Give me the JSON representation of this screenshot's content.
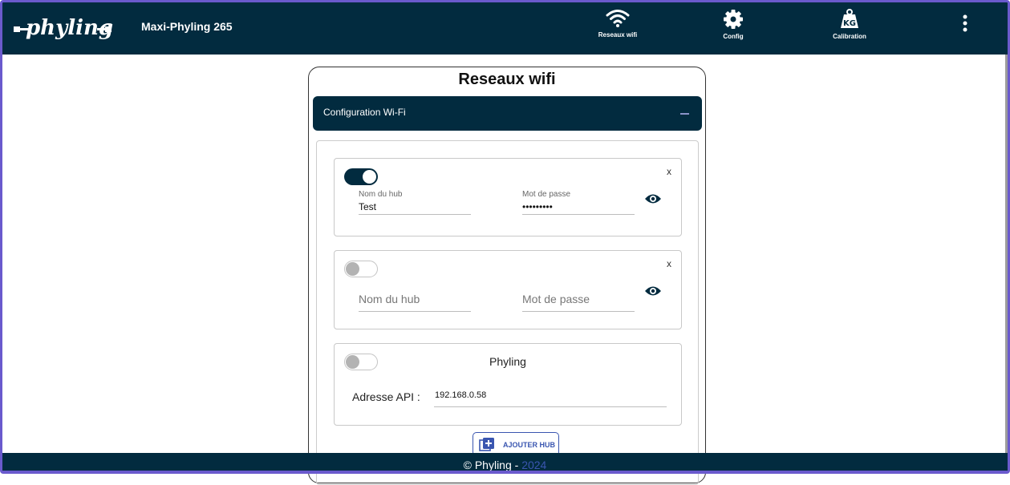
{
  "header": {
    "brand": "phyling",
    "app_title": "Maxi-Phyling 265",
    "nav": [
      {
        "label": "Reseaux wifi",
        "icon": "wifi-icon"
      },
      {
        "label": "Config",
        "icon": "gear-icon"
      },
      {
        "label": "Calibration",
        "icon": "weight-kg-icon"
      }
    ],
    "more_icon": "more-vertical-icon"
  },
  "main": {
    "title": "Reseaux wifi",
    "accordion": {
      "title": "Configuration Wi-Fi",
      "collapse_icon": "minus-icon"
    },
    "hubs": [
      {
        "enabled": true,
        "name_label": "Nom du hub",
        "name_value": "Test",
        "password_label": "Mot de passe",
        "password_value": "•••••••••",
        "remove_label": "x"
      },
      {
        "enabled": false,
        "name_placeholder": "Nom du hub",
        "password_placeholder": "Mot de passe",
        "remove_label": "x"
      }
    ],
    "phyling_hub": {
      "enabled": false,
      "name": "Phyling",
      "api_label": "Adresse API :",
      "api_value": "192.168.0.58"
    },
    "add_hub_label": "AJOUTER HUB"
  },
  "footer": {
    "text": "© Phyling - ",
    "year": "2024"
  },
  "colors": {
    "primary": "#022b3f",
    "accent": "#3a56b0",
    "frame": "#6a5acd"
  }
}
